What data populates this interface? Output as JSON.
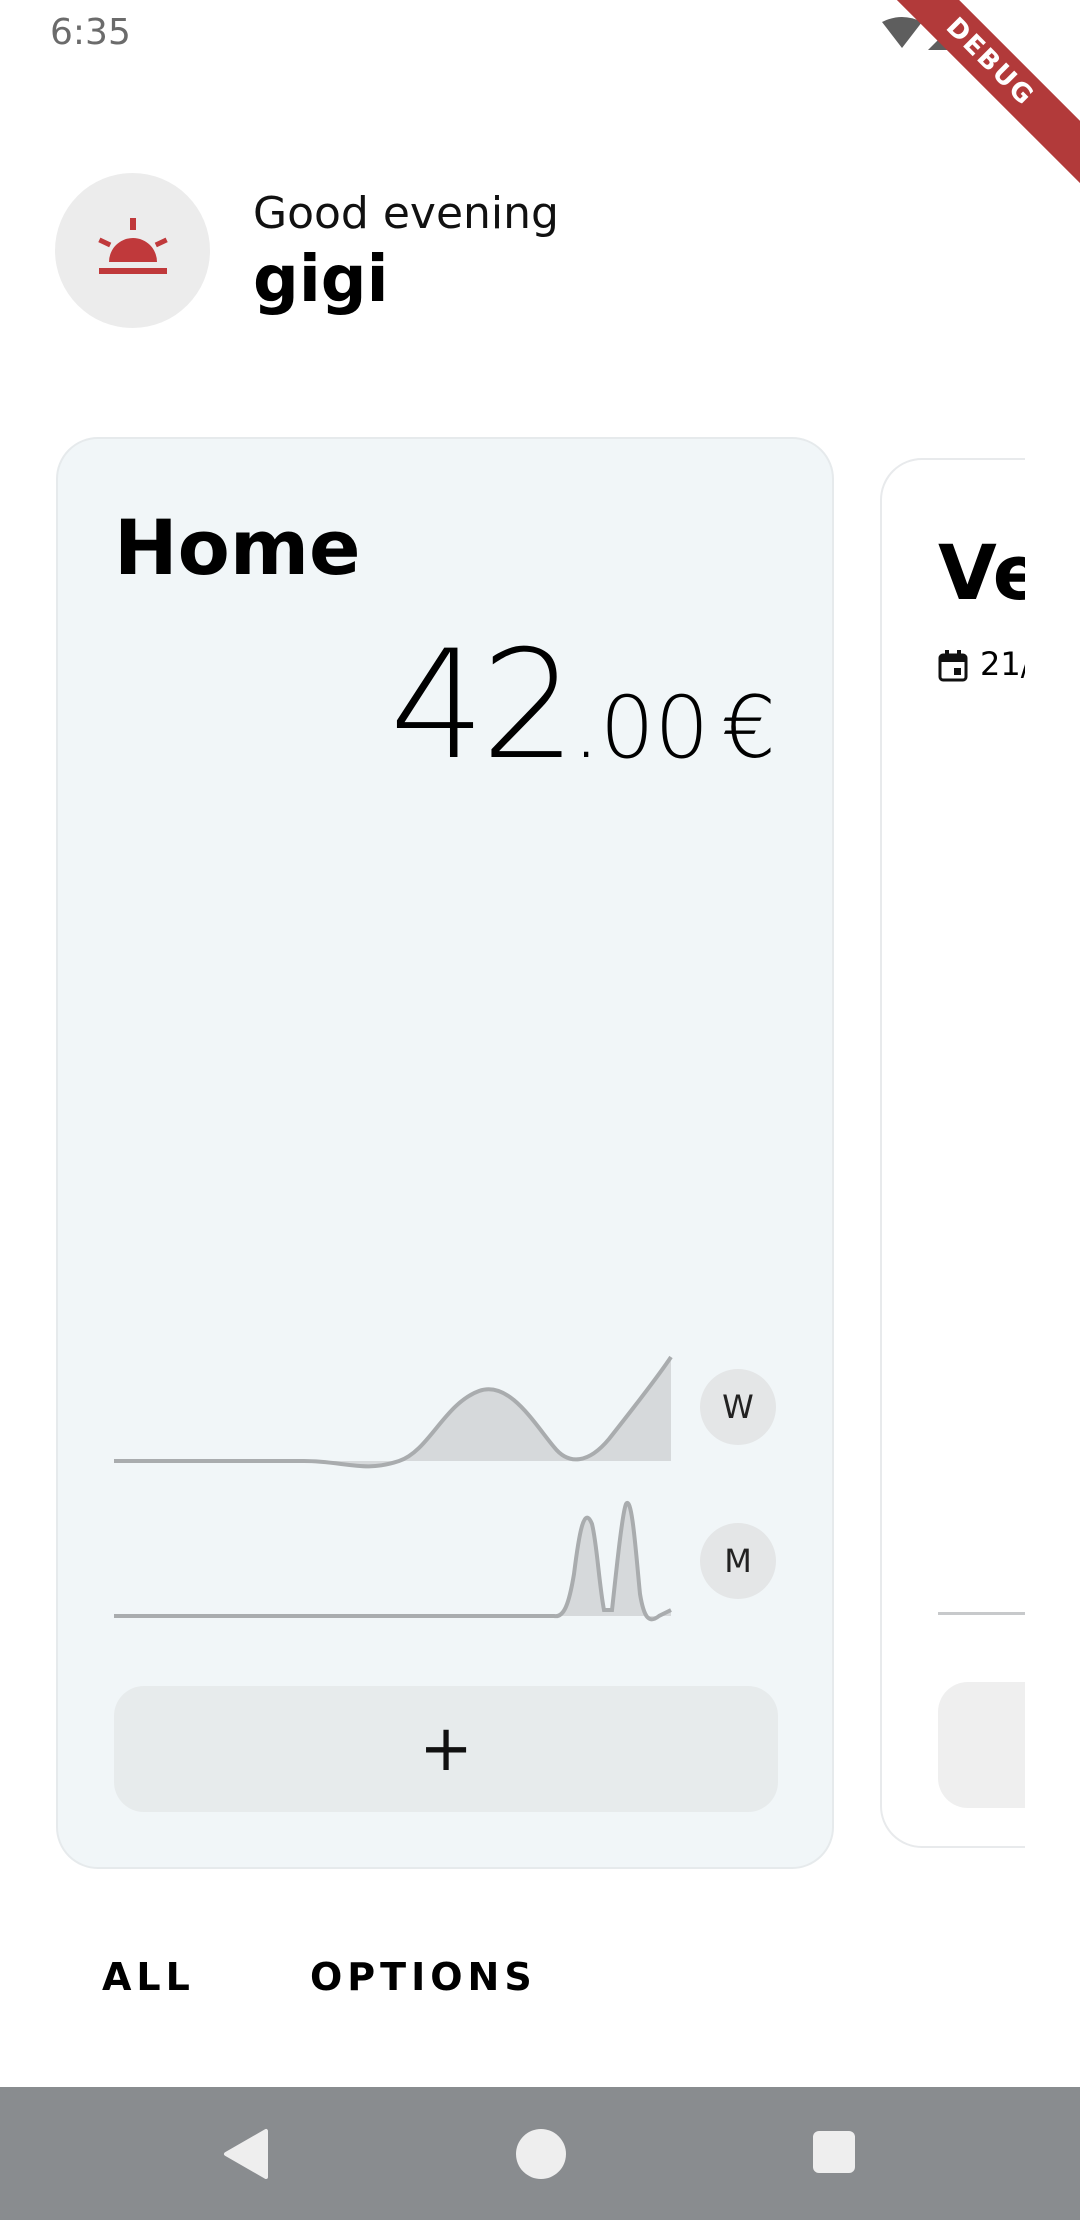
{
  "status_bar": {
    "time": "6:35",
    "debug_label": "DEBUG"
  },
  "header": {
    "greeting": "Good evening",
    "username": "gigi",
    "avatar_icon": "siren-alarm-icon",
    "accent_color": "#c0393b"
  },
  "cards": [
    {
      "title": "Home",
      "amount": {
        "integer": "42",
        "decimal": ".00",
        "currency": "€"
      },
      "graphs": [
        {
          "period": "W"
        },
        {
          "period": "M"
        }
      ],
      "add_button_label": "+"
    },
    {
      "title": "Ve",
      "date": "21/"
    }
  ],
  "tabs": [
    {
      "label": "ALL"
    },
    {
      "label": "OPTIONS"
    }
  ],
  "nav": {
    "back_icon": "back-triangle-icon",
    "home_icon": "home-circle-icon",
    "recents_icon": "recents-square-icon"
  }
}
